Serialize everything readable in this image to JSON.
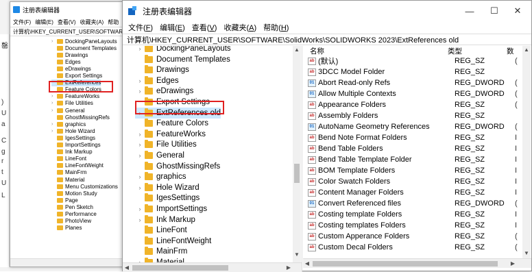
{
  "back_window": {
    "title": "注册表编辑器",
    "menu": [
      "文件(F)",
      "编辑(E)",
      "查看(V)",
      "收藏夹(A)",
      "帮助"
    ],
    "address": "计算机\\HKEY_CURRENT_USER\\SOFTWARE\\",
    "tree": [
      "DockingPaneLayouts",
      "Document Templates",
      "Drawings",
      "Edges",
      "eDrawings",
      "Export Settings",
      "ExtReferences",
      "Feature Colors",
      "FeatureWorks",
      "File Utilities",
      "General",
      "GhostMissingRefs",
      "graphics",
      "Hole Wizard",
      "IgesSettings",
      "ImportSettings",
      "Ink Markup",
      "LineFont",
      "LineFontWeight",
      "MainFrm",
      "Material",
      "Menu Customizations",
      "Motion Study",
      "Page",
      "Pen Sketch",
      "Performance",
      "PhotoView",
      "Planes"
    ]
  },
  "left_peek": [
    "罄",
    ")",
    "U",
    "a",
    "C",
    "g",
    "r",
    "t",
    "U",
    "L"
  ],
  "main_window": {
    "title": "注册表编辑器",
    "controls": {
      "minimize": "—",
      "maximize": "☐",
      "close": "✕"
    },
    "menu": [
      {
        "pre": "文件(",
        "key": "F",
        "post": ")"
      },
      {
        "pre": "编辑(",
        "key": "E",
        "post": ")"
      },
      {
        "pre": "查看(",
        "key": "V",
        "post": ")"
      },
      {
        "pre": "收藏夹(",
        "key": "A",
        "post": ")"
      },
      {
        "pre": "帮助(",
        "key": "H",
        "post": ")"
      }
    ],
    "address": "计算机\\HKEY_CURRENT_USER\\SOFTWARE\\SolidWorks\\SOLIDWORKS 2023\\ExtReferences old",
    "tree": [
      {
        "label": "DockingPaneLayouts",
        "expandable": true
      },
      {
        "label": "Document Templates",
        "expandable": false
      },
      {
        "label": "Drawings",
        "expandable": false
      },
      {
        "label": "Edges",
        "expandable": true
      },
      {
        "label": "eDrawings",
        "expandable": true
      },
      {
        "label": "Export Settings",
        "expandable": false
      },
      {
        "label": "ExtReferences old",
        "expandable": true,
        "selected": true
      },
      {
        "label": "Feature Colors",
        "expandable": false
      },
      {
        "label": "FeatureWorks",
        "expandable": true
      },
      {
        "label": "File Utilities",
        "expandable": true
      },
      {
        "label": "General",
        "expandable": true
      },
      {
        "label": "GhostMissingRefs",
        "expandable": false
      },
      {
        "label": "graphics",
        "expandable": true
      },
      {
        "label": "Hole Wizard",
        "expandable": true
      },
      {
        "label": "IgesSettings",
        "expandable": false
      },
      {
        "label": "ImportSettings",
        "expandable": true
      },
      {
        "label": "Ink Markup",
        "expandable": true
      },
      {
        "label": "LineFont",
        "expandable": false
      },
      {
        "label": "LineFontWeight",
        "expandable": false
      },
      {
        "label": "MainFrm",
        "expandable": false
      },
      {
        "label": "Material",
        "expandable": true
      }
    ],
    "list_header": {
      "name": "名称",
      "type": "类型",
      "data": "数"
    },
    "values": [
      {
        "name": "(默认)",
        "type": "REG_SZ",
        "icon": "ab",
        "data": "("
      },
      {
        "name": "3DCC Model Folder",
        "type": "REG_SZ",
        "icon": "ab",
        "data": ""
      },
      {
        "name": "Abort Read-only Refs",
        "type": "REG_DWORD",
        "icon": "dword",
        "data": "("
      },
      {
        "name": "Allow Multiple Contexts",
        "type": "REG_DWORD",
        "icon": "dword",
        "data": "("
      },
      {
        "name": "Appearance Folders",
        "type": "REG_SZ",
        "icon": "ab",
        "data": "("
      },
      {
        "name": "Assembly Folders",
        "type": "REG_SZ",
        "icon": "ab",
        "data": ""
      },
      {
        "name": "AutoName Geometry References",
        "type": "REG_DWORD",
        "icon": "dword",
        "data": "("
      },
      {
        "name": "Bend Note Format Folders",
        "type": "REG_SZ",
        "icon": "ab",
        "data": "I"
      },
      {
        "name": "Bend Table Folders",
        "type": "REG_SZ",
        "icon": "ab",
        "data": "I"
      },
      {
        "name": "Bend Table Template Folder",
        "type": "REG_SZ",
        "icon": "ab",
        "data": "I"
      },
      {
        "name": "BOM Template Folders",
        "type": "REG_SZ",
        "icon": "ab",
        "data": "I"
      },
      {
        "name": "Color Swatch Folders",
        "type": "REG_SZ",
        "icon": "ab",
        "data": "I"
      },
      {
        "name": "Content Manager Folders",
        "type": "REG_SZ",
        "icon": "ab",
        "data": "I"
      },
      {
        "name": "Convert Referenced files",
        "type": "REG_DWORD",
        "icon": "dword",
        "data": "("
      },
      {
        "name": "Costing template Folders",
        "type": "REG_SZ",
        "icon": "ab",
        "data": "I"
      },
      {
        "name": "Costing templates Folders",
        "type": "REG_SZ",
        "icon": "ab",
        "data": "I"
      },
      {
        "name": "Custom Apperance Folders",
        "type": "REG_SZ",
        "icon": "ab",
        "data": "("
      },
      {
        "name": "Custom Decal Folders",
        "type": "REG_SZ",
        "icon": "ab",
        "data": "("
      }
    ]
  },
  "colors": {
    "highlight": "#e02020",
    "selection": "#cce8ff",
    "folder": "#f0b429"
  }
}
